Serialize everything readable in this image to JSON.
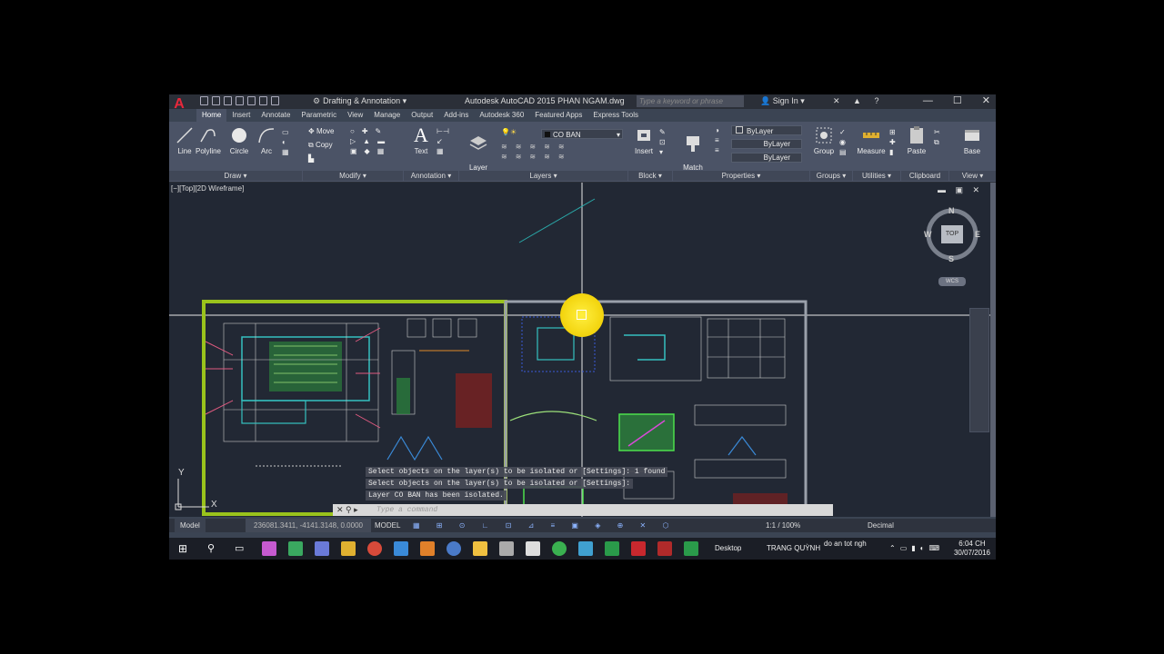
{
  "app": {
    "title": "Autodesk AutoCAD 2015   PHAN NGAM.dwg",
    "logo": "A",
    "workspace": "Drafting & Annotation",
    "search_placeholder": "Type a keyword or phrase",
    "signin": "Sign In",
    "win_min": "—",
    "win_max": "☐",
    "win_close": "✕"
  },
  "tabs": [
    "Home",
    "Insert",
    "Annotate",
    "Parametric",
    "View",
    "Manage",
    "Output",
    "Add-ins",
    "Autodesk 360",
    "Featured Apps",
    "Express Tools"
  ],
  "ribbon": {
    "draw": {
      "title": "Draw ▾",
      "line": "Line",
      "polyline": "Polyline",
      "circle": "Circle",
      "arc": "Arc"
    },
    "modify": {
      "title": "Modify ▾",
      "move": "Move",
      "copy": "Copy"
    },
    "annotation": {
      "title": "Annotation ▾",
      "text": "Text"
    },
    "layers": {
      "title": "Layers ▾",
      "layer_properties": "Layer\nProperties",
      "current_layer": "CO BAN"
    },
    "block": {
      "title": "Block ▾",
      "insert": "Insert"
    },
    "properties": {
      "title": "Properties ▾",
      "match": "Match\nProperties",
      "color": "ByLayer",
      "linetype": "ByLayer",
      "lineweight": "ByLayer"
    },
    "groups": {
      "title": "Groups ▾",
      "group": "Group"
    },
    "utilities": {
      "title": "Utilities ▾",
      "measure": "Measure"
    },
    "clipboard": {
      "title": "Clipboard",
      "paste": "Paste"
    },
    "view": {
      "title": "View ▾",
      "base": "Base"
    }
  },
  "viewport": {
    "label": "[−][Top][2D Wireframe]",
    "compass": {
      "n": "N",
      "s": "S",
      "e": "E",
      "w": "W",
      "cube": "TOP",
      "wcs": "WCS"
    },
    "ucs_y": "Y",
    "ucs_x": "X"
  },
  "command": {
    "history": [
      "Select objects on the layer(s) to be isolated or [Settings]: 1 found",
      "Select objects on the layer(s) to be isolated or [Settings]:",
      "Layer CO BAN has been isolated."
    ],
    "placeholder": "Type a command"
  },
  "status": {
    "model_tab": "Model",
    "coords": "236081.3411, -4141.3148, 0.0000",
    "model": "MODEL",
    "scale": "1:1 / 100%",
    "units": "Decimal"
  },
  "taskbar": {
    "desktop": "Desktop",
    "user": "TRANG QUỲNH",
    "folder": "do an tot ngh",
    "time": "6:04 CH",
    "date": "30/07/2016"
  },
  "colors": {
    "app_bg": "#3b4453",
    "canvas_bg": "#222834",
    "accent_green": "#9ac31c",
    "highlight_yellow": "#f2d30c"
  }
}
